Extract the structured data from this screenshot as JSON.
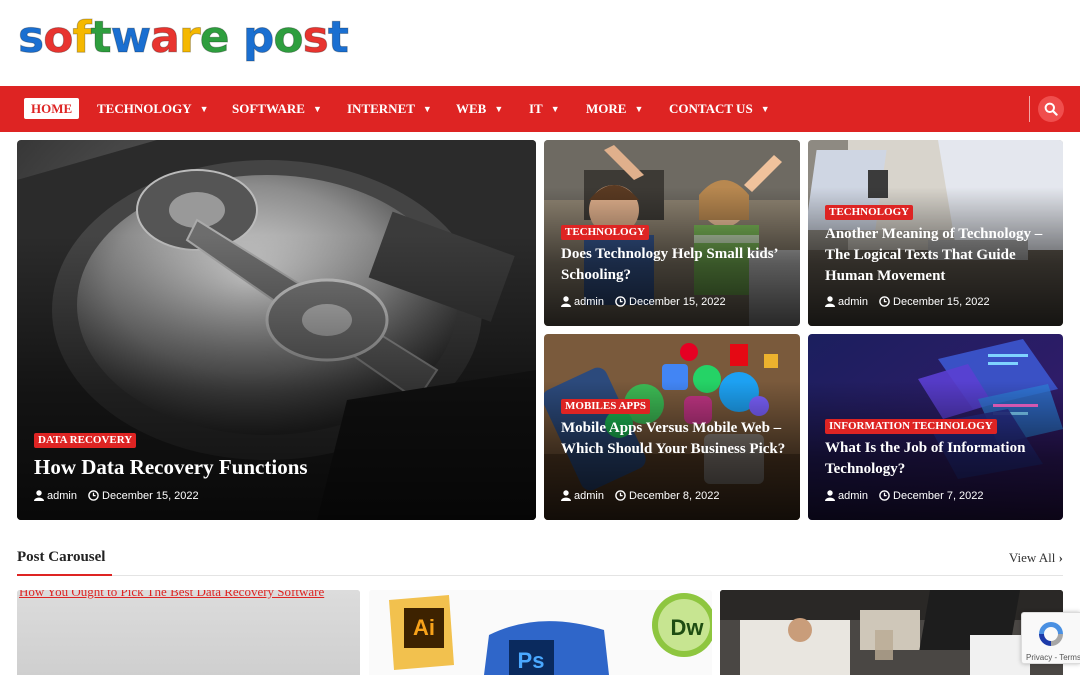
{
  "site": {
    "logo_word1": "software",
    "logo_word2": "post",
    "logo_colors": [
      "#1a6fd1",
      "#e8342f",
      "#f5b800",
      "#2e9e3e"
    ]
  },
  "nav": {
    "home": "HOME",
    "items": [
      {
        "label": "TECHNOLOGY",
        "chevron": "chevron-down-icon"
      },
      {
        "label": "SOFTWARE",
        "chevron": "chevron-down-icon"
      },
      {
        "label": "INTERNET",
        "chevron": "chevron-down-icon"
      },
      {
        "label": "WEB",
        "chevron": "chevron-down-icon"
      },
      {
        "label": "IT",
        "chevron": "chevron-down-icon"
      },
      {
        "label": "MORE",
        "chevron": "chevron-down-icon"
      },
      {
        "label": "CONTACT US",
        "chevron": "chevron-down-icon"
      }
    ],
    "search_icon": "search-icon",
    "bar_color": "#de2423"
  },
  "featured": [
    {
      "category": "DATA RECOVERY",
      "title": "How Data Recovery Functions",
      "author": "admin",
      "date": "December 15, 2022"
    },
    {
      "category": "TECHNOLOGY",
      "title": "Does Technology Help Small kids’ Schooling?",
      "author": "admin",
      "date": "December 15, 2022"
    },
    {
      "category": "TECHNOLOGY",
      "title": "Another Meaning of Technology – The Logical Texts That Guide Human Movement",
      "author": "admin",
      "date": "December 15, 2022"
    },
    {
      "category": "MOBILES APPS",
      "title": "Mobile Apps Versus Mobile Web – Which Should Your Business Pick?",
      "author": "admin",
      "date": "December 8, 2022"
    },
    {
      "category": "INFORMATION TECHNOLOGY",
      "title": "What Is the Job of Information Technology?",
      "author": "admin",
      "date": "December 7, 2022"
    }
  ],
  "carousel": {
    "title": "Post Carousel",
    "view_all": "View All",
    "first_image_alt": "How You Ought to Pick The Best Data Recovery Software"
  },
  "recaptcha": {
    "links": "Privacy - Terms"
  }
}
